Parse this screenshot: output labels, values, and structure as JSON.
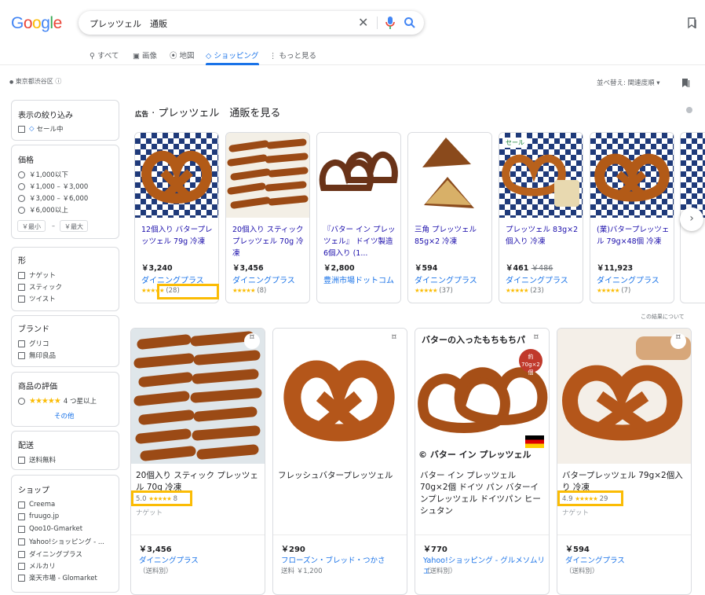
{
  "logo": "Google",
  "search": {
    "query": "プレッツェル　通販"
  },
  "tabs": [
    {
      "label": "すべて",
      "icon": "search-icon"
    },
    {
      "label": "画像",
      "icon": "image-icon"
    },
    {
      "label": "地図",
      "icon": "pin-icon"
    },
    {
      "label": "ショッピング",
      "icon": "tag-icon",
      "active": true
    },
    {
      "label": "もっと見る",
      "icon": "more-icon"
    }
  ],
  "location": "東京都渋谷区",
  "sort": "並べ替え: 関連度順",
  "filters": {
    "narrow": {
      "title": "表示の絞り込み",
      "items": [
        "セール中"
      ]
    },
    "price": {
      "title": "価格",
      "items": [
        "￥1,000以下",
        "￥1,000 – ￥3,000",
        "￥3,000 – ￥6,000",
        "￥6,000以上"
      ],
      "min": "￥最小",
      "dash": "–",
      "max": "￥最大"
    },
    "shape": {
      "title": "形",
      "items": [
        "ナゲット",
        "スティック",
        "ツイスト"
      ]
    },
    "brand": {
      "title": "ブランド",
      "items": [
        "グリコ",
        "無印良品"
      ]
    },
    "rating": {
      "title": "商品の評価",
      "stars": "★★★★★",
      "label": "4 つ星以上",
      "more": "その他"
    },
    "delivery": {
      "title": "配送",
      "items": [
        "送料無料"
      ]
    },
    "shop": {
      "title": "ショップ",
      "items": [
        "Creema",
        "fruugo.jp",
        "Qoo10-Gmarket",
        "Yahoo!ショッピング - ...",
        "ダイニングプラス",
        "メルカリ",
        "楽天市場 - Glomarket"
      ]
    }
  },
  "ads": {
    "label": "広告",
    "heading": "· プレッツェル　通販を見る",
    "about": "この結果について",
    "items": [
      {
        "title": "12個入り バタープレッツェル 79g 冷凍",
        "price": "￥3,240",
        "old": "",
        "shop": "ダイニングプラス",
        "stars": "★★★★★",
        "count": "(28)",
        "badge": ""
      },
      {
        "title": "20個入り スティックプレッツェル 70g 冷凍",
        "price": "￥3,456",
        "old": "",
        "shop": "ダイニングプラス",
        "stars": "★★★★★",
        "count": "(8)",
        "badge": ""
      },
      {
        "title": "『バター イン プレッツェル』 ドイツ製造 6個入り (1...",
        "price": "￥2,800",
        "old": "",
        "shop": "豊洲市場ドットコム",
        "stars": "",
        "count": "",
        "badge": ""
      },
      {
        "title": "三角 プレッツェル 85g×2 冷凍",
        "price": "￥594",
        "old": "",
        "shop": "ダイニングプラス",
        "stars": "★★★★★",
        "count": "(37)",
        "badge": ""
      },
      {
        "title": "プレッツェル 83g×2個入り 冷凍",
        "price": "￥461",
        "old": "￥486",
        "shop": "ダイニングプラス",
        "stars": "★★★★★",
        "count": "(23)",
        "badge": "セール"
      },
      {
        "title": "(業)バタープレッツェル 79g×48個 冷凍",
        "price": "￥11,923",
        "old": "",
        "shop": "ダイニングプラス",
        "stars": "★★★★★",
        "count": "(7)",
        "badge": ""
      }
    ]
  },
  "results": [
    {
      "title": "20個入り スティック プレッツェル 70g 冷凍",
      "score": "5.0",
      "stars": "★★★★★",
      "count": "8",
      "sub": "ナゲット",
      "price": "￥3,456",
      "shop": "ダイニングプラス",
      "ship": "（送料別）",
      "overlay": ""
    },
    {
      "title": "フレッシュバタープレッツェル",
      "score": "",
      "stars": "",
      "count": "",
      "sub": "",
      "price": "￥290",
      "shop": "フローズン・ブレッド・つかさ",
      "ship": "送料 ￥1,200",
      "overlay": ""
    },
    {
      "title": "バター イン プレッツェル 70g×2個 ドイツ パン バターインプレッツェル ドイツパン ヒーシュタン",
      "score": "",
      "stars": "",
      "count": "",
      "sub": "",
      "price": "￥770",
      "shop": "Yahoo!ショッピング - グルメソムリエ",
      "ship": "（送料別）",
      "overlay": "バターの入ったもちもちパ",
      "overlay2": "バター イン プレッツェル",
      "badge": "約70g×2個"
    },
    {
      "title": "バタープレッツェル 79g×2個入り 冷凍",
      "score": "4.9",
      "stars": "★★★★★",
      "count": "29",
      "sub": "ナゲット",
      "price": "￥594",
      "shop": "ダイニングプラス",
      "ship": "（送料別）",
      "overlay": ""
    }
  ]
}
